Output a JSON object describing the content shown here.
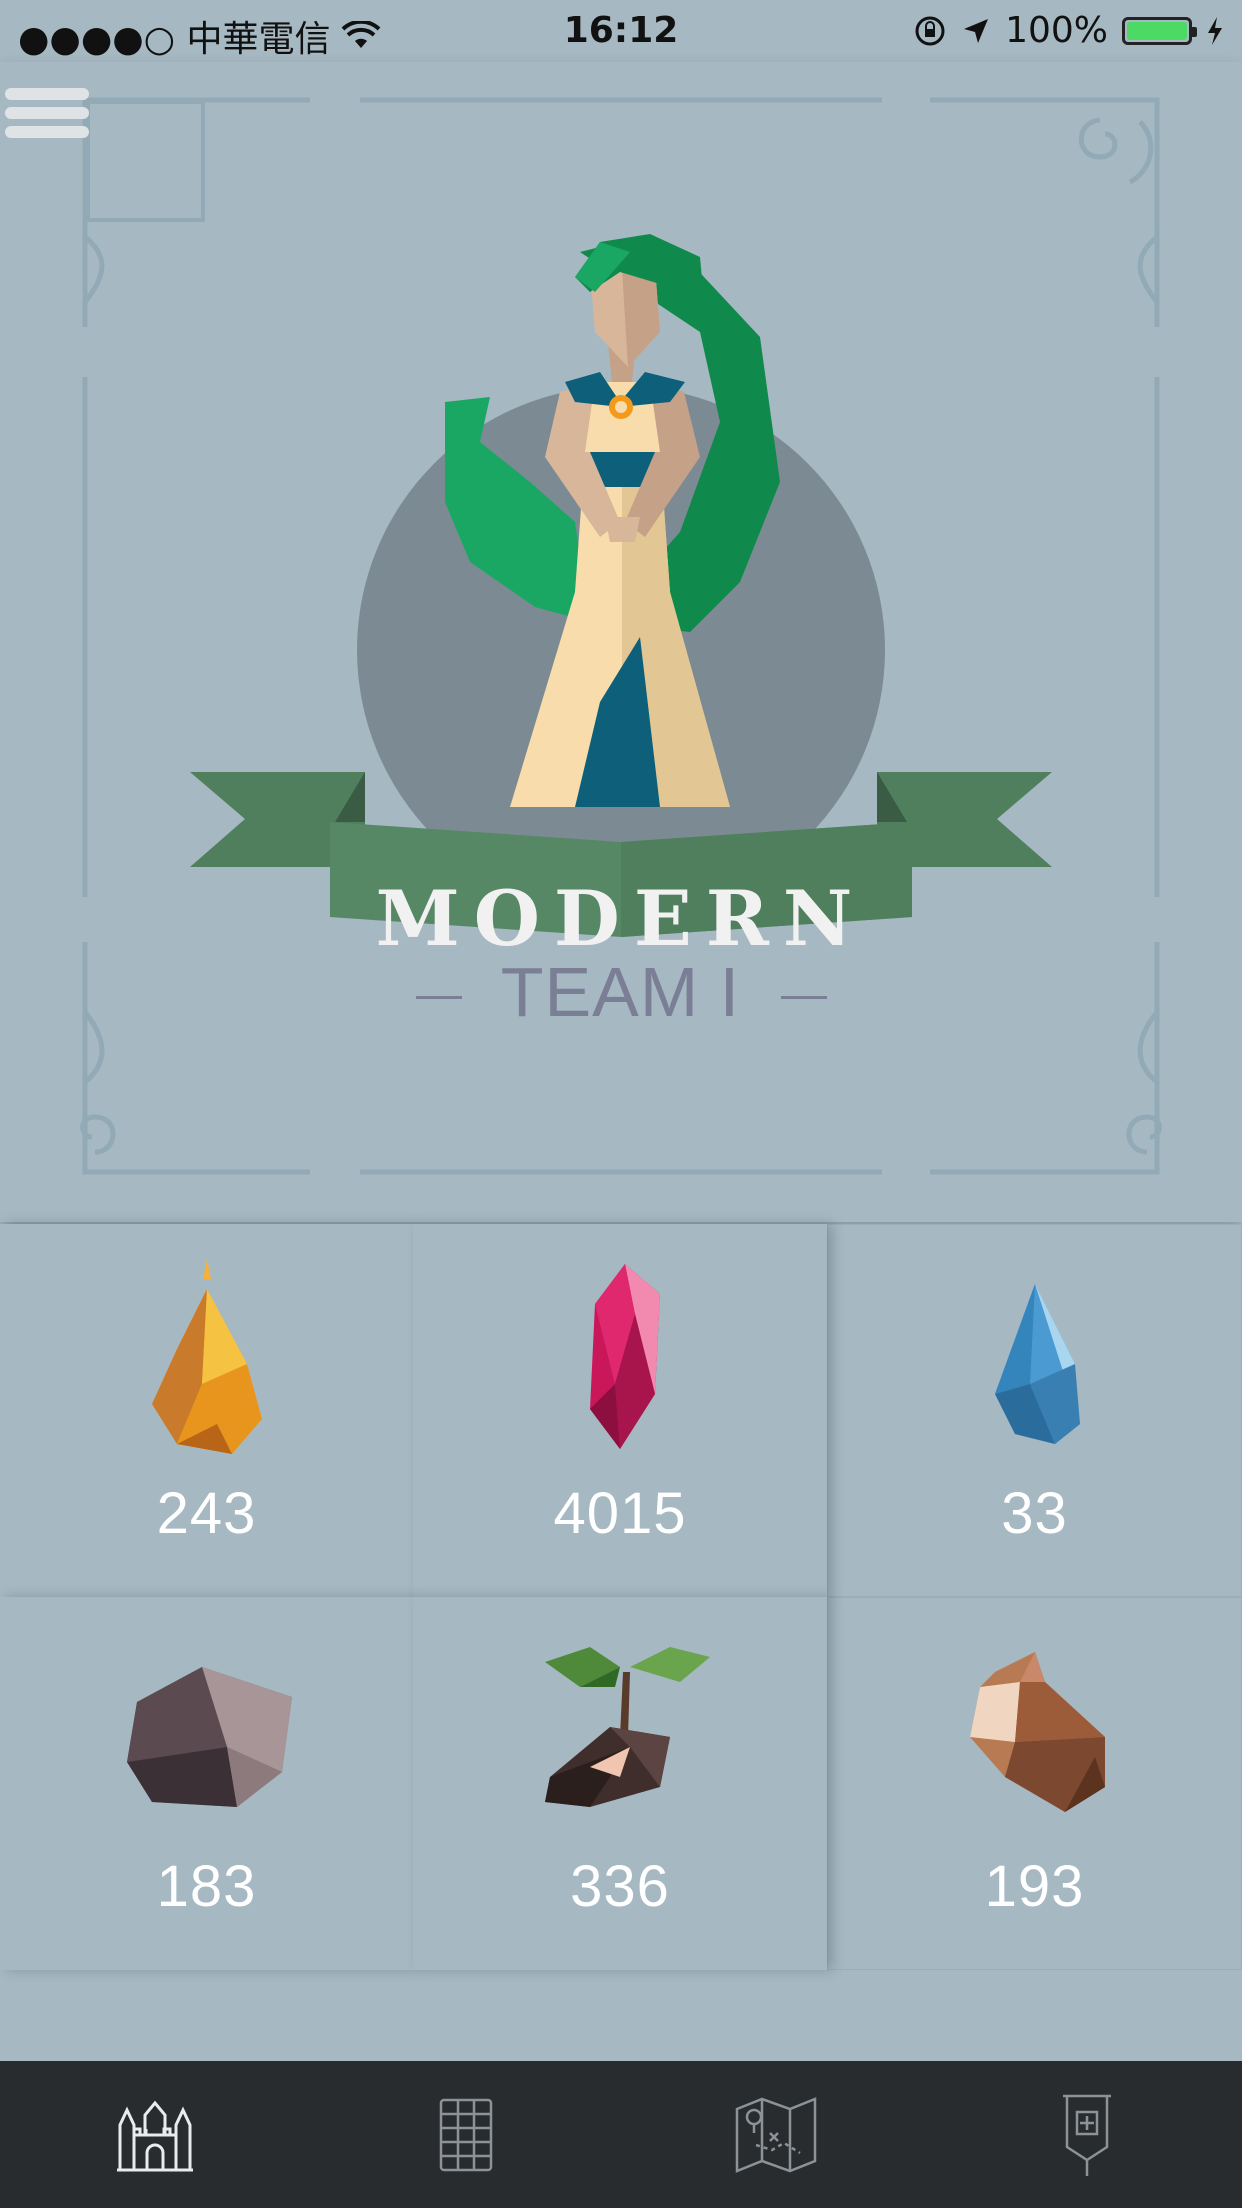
{
  "status_bar": {
    "carrier": "●●●●○ 中華電信",
    "time": "16:12",
    "battery": "100%"
  },
  "hero": {
    "banner_text": "MODERN",
    "team_label": "TEAM I"
  },
  "resources": [
    {
      "icon": "fire-crystal-icon",
      "count": "243"
    },
    {
      "icon": "ruby-crystal-icon",
      "count": "4015"
    },
    {
      "icon": "water-drop-icon",
      "count": "33"
    },
    {
      "icon": "stone-icon",
      "count": "183"
    },
    {
      "icon": "sprout-icon",
      "count": "336"
    },
    {
      "icon": "wood-log-icon",
      "count": "193"
    }
  ],
  "tabbar": {
    "tabs": [
      {
        "icon": "castle-icon"
      },
      {
        "icon": "grid-icon"
      },
      {
        "icon": "map-icon"
      },
      {
        "icon": "banner-flag-icon"
      }
    ]
  },
  "colors": {
    "background": "#a6b8c2",
    "banner_green": "#4f7f5c",
    "tabbar": "#292c2e",
    "team_text": "#7b7f96"
  }
}
